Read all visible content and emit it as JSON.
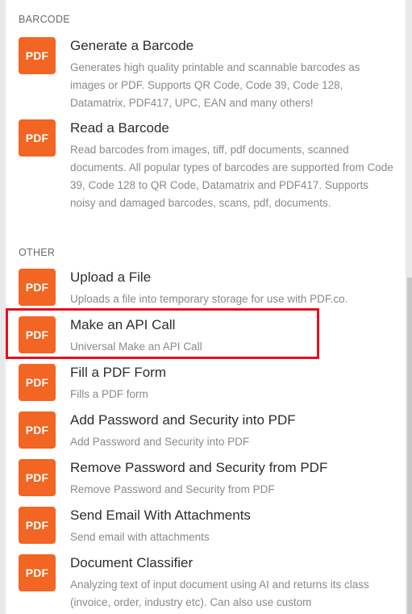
{
  "sections": [
    {
      "header": "BARCODE"
    },
    {
      "header": "OTHER"
    }
  ],
  "badge_label": "PDF",
  "modules": [
    {
      "title": "Generate a Barcode",
      "description": "Generates high quality printable and scannable barcodes as images or PDF. Supports QR Code, Code 39, Code 128, Datamatrix, PDF417, UPC, EAN and many others!"
    },
    {
      "title": "Read a Barcode",
      "description": "Read barcodes from images, tiff, pdf documents, scanned documents. All popular types of barcodes are supported from Code 39, Code 128 to QR Code, Datamatrix and PDF417. Supports noisy and damaged barcodes, scans, pdf, documents."
    },
    {
      "title": "Upload a File",
      "description": "Uploads a file into temporary storage for use with PDF.co."
    },
    {
      "title": "Make an API Call",
      "description": "Universal Make an API Call"
    },
    {
      "title": "Fill a PDF Form",
      "description": "Fills a PDF form"
    },
    {
      "title": "Add Password and Security into PDF",
      "description": "Add Password and Security into PDF"
    },
    {
      "title": "Remove Password and Security from PDF",
      "description": "Remove Password and Security from PDF"
    },
    {
      "title": "Send Email With Attachments",
      "description": "Send email with attachments"
    },
    {
      "title": "Document Classifier",
      "description": "Analyzing text of input document using AI and returns its class (invoice, order, industry etc). Can also use custom"
    }
  ],
  "colors": {
    "badge": "#f26522",
    "highlight": "#e3111e"
  }
}
